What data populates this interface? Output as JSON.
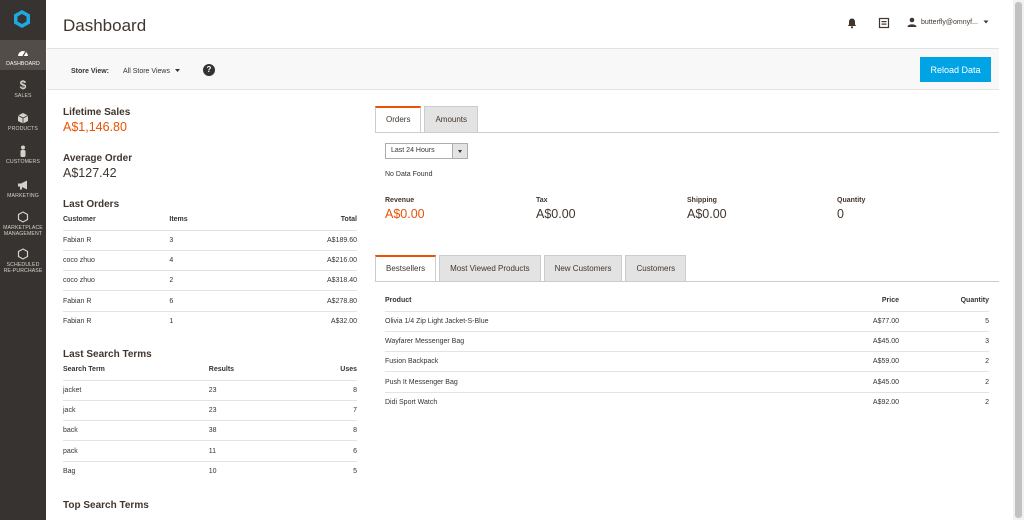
{
  "sidebar": {
    "items": [
      {
        "label": "DASHBOARD",
        "icon": "dashboard-icon"
      },
      {
        "label": "SALES",
        "icon": "dollar-icon"
      },
      {
        "label": "PRODUCTS",
        "icon": "cube-icon"
      },
      {
        "label": "CUSTOMERS",
        "icon": "person-icon"
      },
      {
        "label": "MARKETING",
        "icon": "megaphone-icon"
      },
      {
        "label1": "MARKETPLACE",
        "label2": "MANAGEMENT",
        "icon": "hexagon-icon"
      },
      {
        "label1": "SCHEDULED",
        "label2": "RE-PURCHASE",
        "icon": "hexagon-icon"
      }
    ]
  },
  "header": {
    "title": "Dashboard",
    "user": "butterfly@omnyf..."
  },
  "store_bar": {
    "label": "Store View:",
    "value": "All Store Views",
    "help": "?",
    "reload": "Reload Data"
  },
  "lifetime_sales": {
    "label": "Lifetime Sales",
    "value": "A$1,146.80"
  },
  "average_order": {
    "label": "Average Order",
    "value": "A$127.42"
  },
  "last_orders": {
    "title": "Last Orders",
    "columns": [
      "Customer",
      "Items",
      "Total"
    ],
    "rows": [
      [
        "Fabian R",
        "3",
        "A$189.60"
      ],
      [
        "coco zhuo",
        "4",
        "A$216.00"
      ],
      [
        "coco zhuo",
        "2",
        "A$318.40"
      ],
      [
        "Fabian R",
        "6",
        "A$278.80"
      ],
      [
        "Fabian R",
        "1",
        "A$32.00"
      ]
    ]
  },
  "last_search": {
    "title": "Last Search Terms",
    "columns": [
      "Search Term",
      "Results",
      "Uses"
    ],
    "rows": [
      [
        "jacket",
        "23",
        "8"
      ],
      [
        "jack",
        "23",
        "7"
      ],
      [
        "back",
        "38",
        "8"
      ],
      [
        "pack",
        "11",
        "6"
      ],
      [
        "Bag",
        "10",
        "5"
      ]
    ]
  },
  "top_search": {
    "title": "Top Search Terms"
  },
  "chart_tabs": {
    "orders": "Orders",
    "amounts": "Amounts"
  },
  "period": {
    "selected": "Last 24 Hours"
  },
  "no_data": "No Data Found",
  "totals": {
    "revenue": {
      "label": "Revenue",
      "value": "A$0.00"
    },
    "tax": {
      "label": "Tax",
      "value": "A$0.00"
    },
    "shipping": {
      "label": "Shipping",
      "value": "A$0.00"
    },
    "quantity": {
      "label": "Quantity",
      "value": "0"
    }
  },
  "grid_tabs": {
    "bestsellers": "Bestsellers",
    "most_viewed": "Most Viewed Products",
    "new_customers": "New Customers",
    "customers": "Customers"
  },
  "bestsellers": {
    "columns": [
      "Product",
      "Price",
      "Quantity"
    ],
    "rows": [
      [
        "Olivia 1/4 Zip Light Jacket-S-Blue",
        "A$77.00",
        "5"
      ],
      [
        "Wayfarer Messenger Bag",
        "A$45.00",
        "3"
      ],
      [
        "Fusion Backpack",
        "A$59.00",
        "2"
      ],
      [
        "Push It Messenger Bag",
        "A$45.00",
        "2"
      ],
      [
        "Didi Sport Watch",
        "A$92.00",
        "2"
      ]
    ]
  },
  "colors": {
    "accent": "#eb5202",
    "button": "#00a4e4",
    "sidebar": "#373330"
  }
}
